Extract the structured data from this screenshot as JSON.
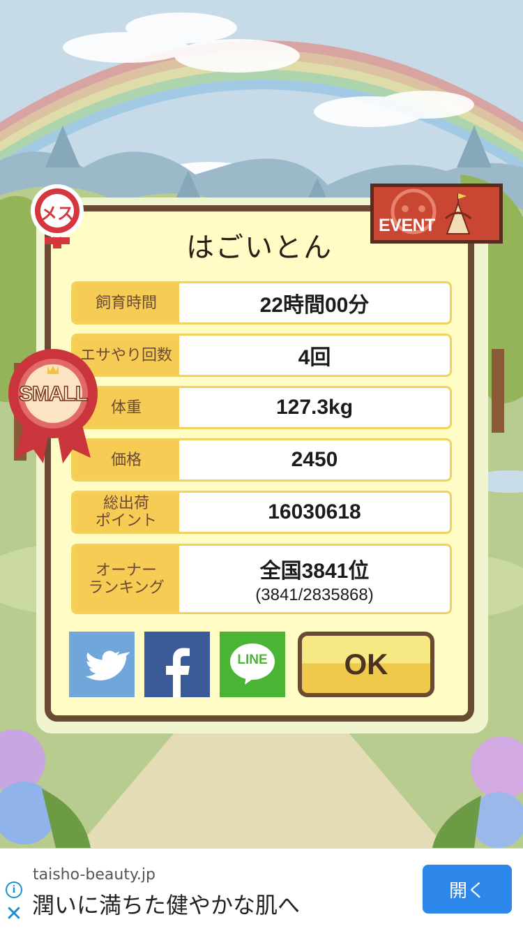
{
  "pet": {
    "name": "はごいとん"
  },
  "badges": {
    "gender": "メス",
    "event": "EVENT",
    "size": "SMALL"
  },
  "stats": [
    {
      "label": "飼育時間",
      "value": "22時間00分"
    },
    {
      "label": "エサやり回数",
      "value": "4回"
    },
    {
      "label": "体重",
      "value": "127.3kg"
    },
    {
      "label": "価格",
      "value": "2450"
    },
    {
      "label": "総出荷\nポイント",
      "value": "16030618"
    }
  ],
  "ranking": {
    "label": "オーナー\nランキング",
    "value": "全国3841位",
    "detail": "(3841/2835868)"
  },
  "share": {
    "twitter_icon": "twitter-bird-icon",
    "facebook_icon": "facebook-f-icon",
    "line_label": "LINE"
  },
  "ok_label": "OK",
  "ad": {
    "domain": "taisho-beauty.jp",
    "headline": "潤いに満ちた健やかな肌へ",
    "button": "開く",
    "info_icon": "i",
    "close_icon": "✕"
  },
  "colors": {
    "dialog_border": "#6a4a32",
    "dialog_fill": "#fffcc5",
    "label_fill": "#f6cc55",
    "ok_top": "#f6e883",
    "ok_bottom": "#efc94b",
    "ad_button": "#2d86e9"
  }
}
